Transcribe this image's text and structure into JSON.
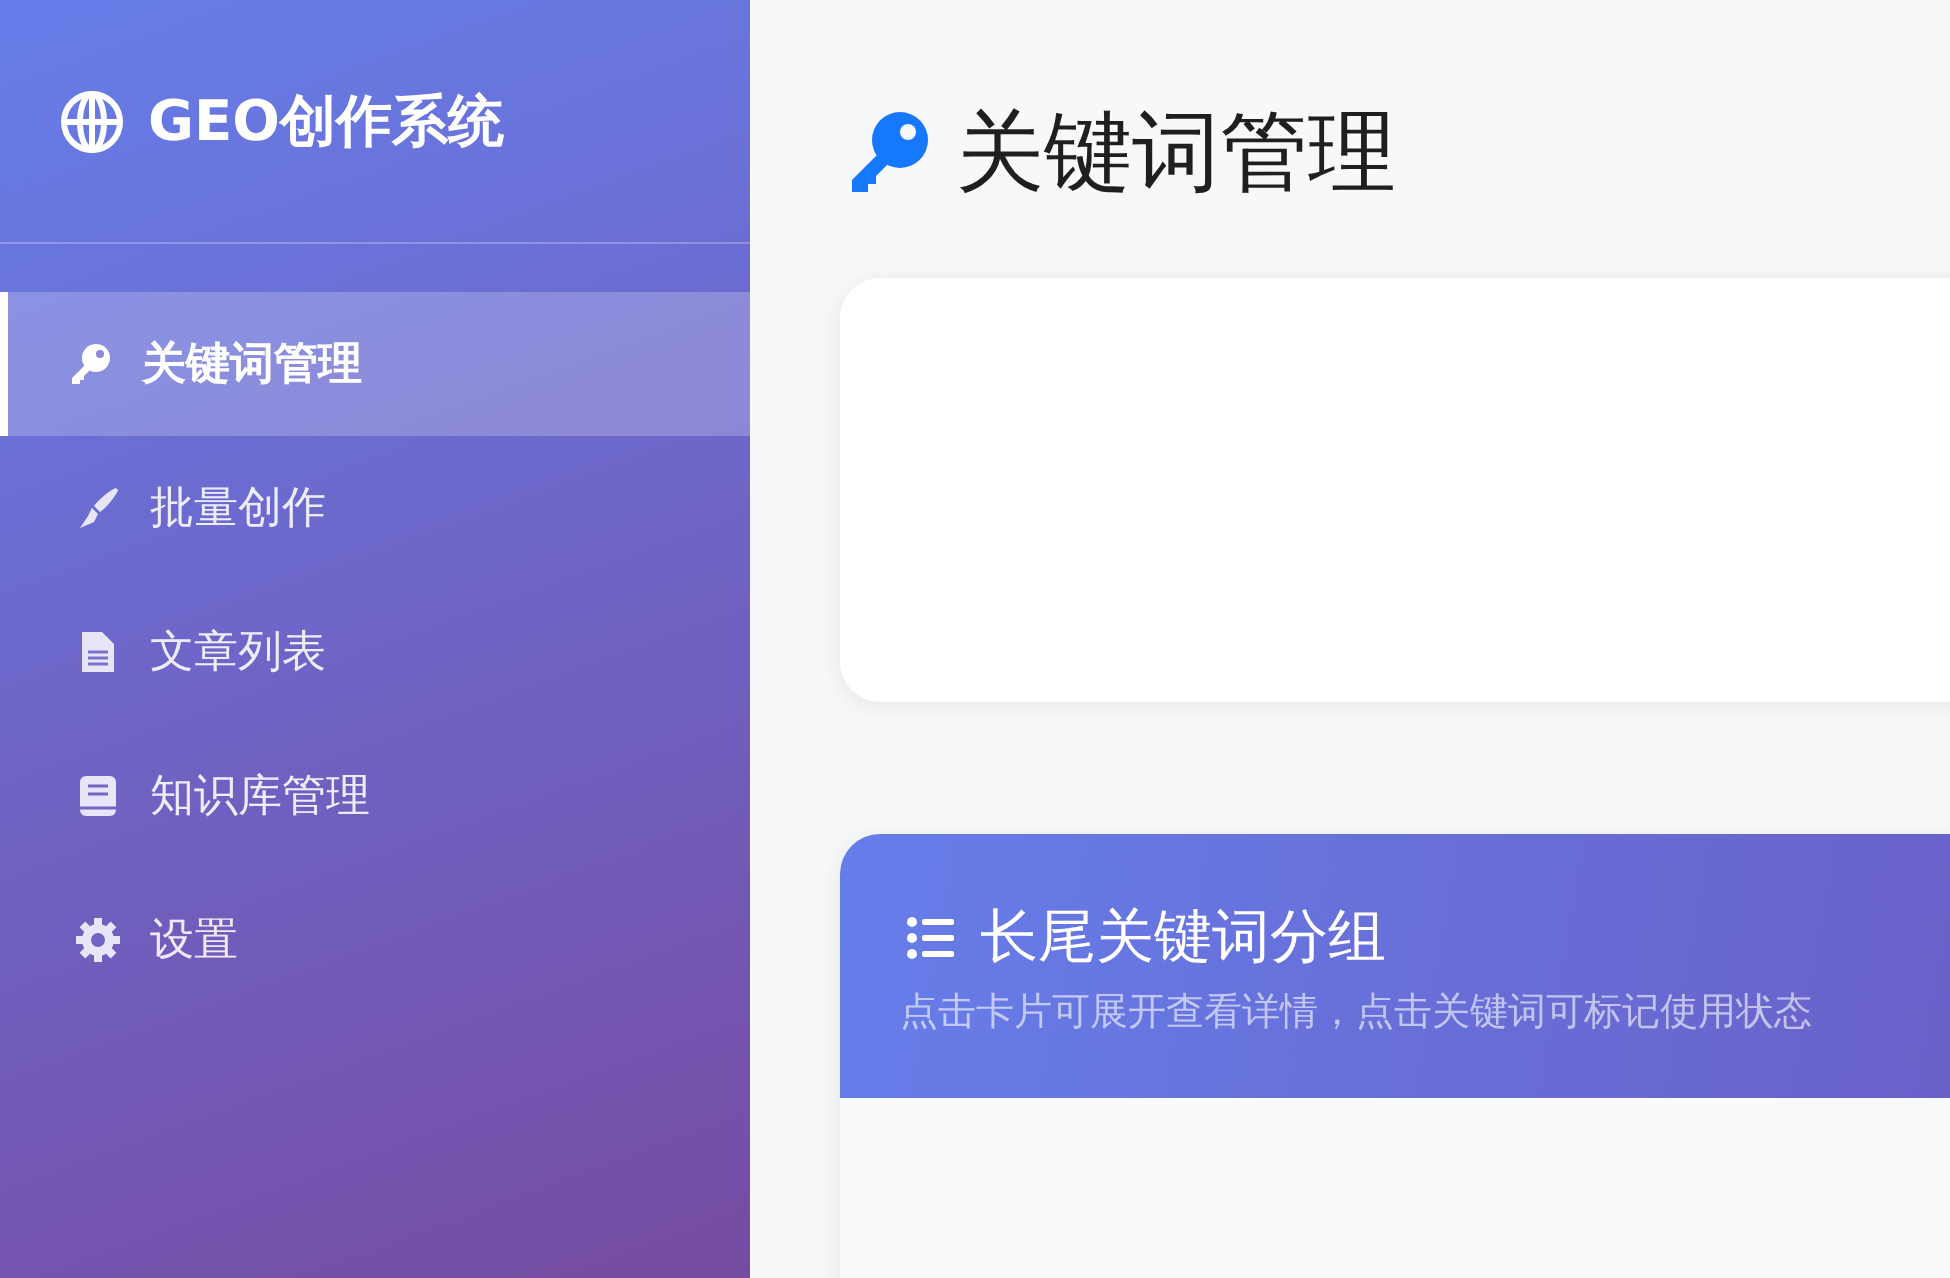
{
  "sidebar": {
    "brand": "GEO创作系统",
    "items": [
      {
        "label": "关键词管理",
        "kind": "key",
        "selected": true
      },
      {
        "label": "批量创作",
        "kind": "pen",
        "selected": false
      },
      {
        "label": "文章列表",
        "kind": "file",
        "selected": false
      },
      {
        "label": "知识库管理",
        "kind": "book",
        "selected": false
      },
      {
        "label": "设置",
        "kind": "gear",
        "selected": false
      }
    ]
  },
  "page": {
    "title": "关键词管理"
  },
  "groups_card": {
    "title": "长尾关键词分组",
    "subtitle": "点击卡片可展开查看详情，点击关键词可标记使用状态"
  }
}
